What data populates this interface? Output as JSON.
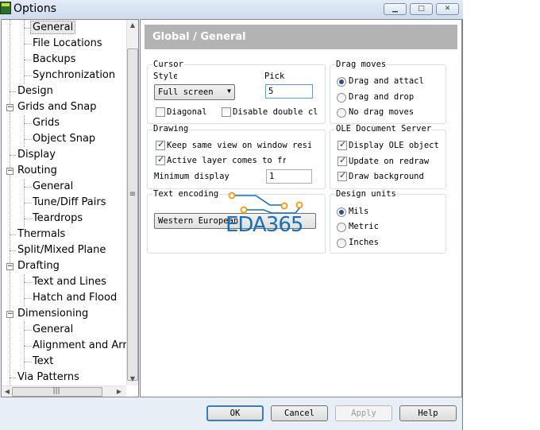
{
  "window": {
    "title": "Options"
  },
  "tree": {
    "items": [
      {
        "label": "General",
        "selected": true
      },
      {
        "label": "File Locations"
      },
      {
        "label": "Backups"
      },
      {
        "label": "Synchronization"
      },
      {
        "label": "Design"
      },
      {
        "label": "Grids and Snap"
      },
      {
        "label": "Grids"
      },
      {
        "label": "Object Snap"
      },
      {
        "label": "Display"
      },
      {
        "label": "Routing"
      },
      {
        "label": "General"
      },
      {
        "label": "Tune/Diff Pairs"
      },
      {
        "label": "Teardrops"
      },
      {
        "label": "Thermals"
      },
      {
        "label": "Split/Mixed Plane"
      },
      {
        "label": "Drafting"
      },
      {
        "label": "Text and Lines"
      },
      {
        "label": "Hatch and Flood"
      },
      {
        "label": "Dimensioning"
      },
      {
        "label": "General"
      },
      {
        "label": "Alignment and Arrows"
      },
      {
        "label": "Text"
      },
      {
        "label": "Via Patterns"
      }
    ]
  },
  "panel": {
    "header": "Global / General",
    "cursor": {
      "group": "Cursor",
      "style_label": "Style",
      "style_value": "Full screen",
      "pick_label": "Pick",
      "pick_value": "5",
      "diagonal": "Diagonal",
      "disable_double_click": "Disable double cli"
    },
    "drag": {
      "group": "Drag moves",
      "opt1": "Drag and attacl",
      "opt2": "Drag and drop",
      "opt3": "No drag moves"
    },
    "drawing": {
      "group": "Drawing",
      "keep_view": "Keep same view on window resiz",
      "active_layer": "Active layer comes to fr",
      "min_display_label": "Minimum display",
      "min_display_value": "1"
    },
    "ole": {
      "group": "OLE Document Server",
      "display": "Display OLE object",
      "update": "Update on redraw",
      "draw_bg": "Draw background"
    },
    "encoding": {
      "group": "Text encoding",
      "value": "Western European"
    },
    "units": {
      "group": "Design units",
      "mils": "Mils",
      "metric": "Metric",
      "inches": "Inches"
    }
  },
  "buttons": {
    "ok": "OK",
    "cancel": "Cancel",
    "apply": "Apply",
    "help": "Help"
  },
  "watermark": {
    "text": "EDA365"
  },
  "colors": {
    "header_bg": "#b3b3b3",
    "watermark_orange": "#f0a020",
    "watermark_blue": "#1a6fb4"
  }
}
